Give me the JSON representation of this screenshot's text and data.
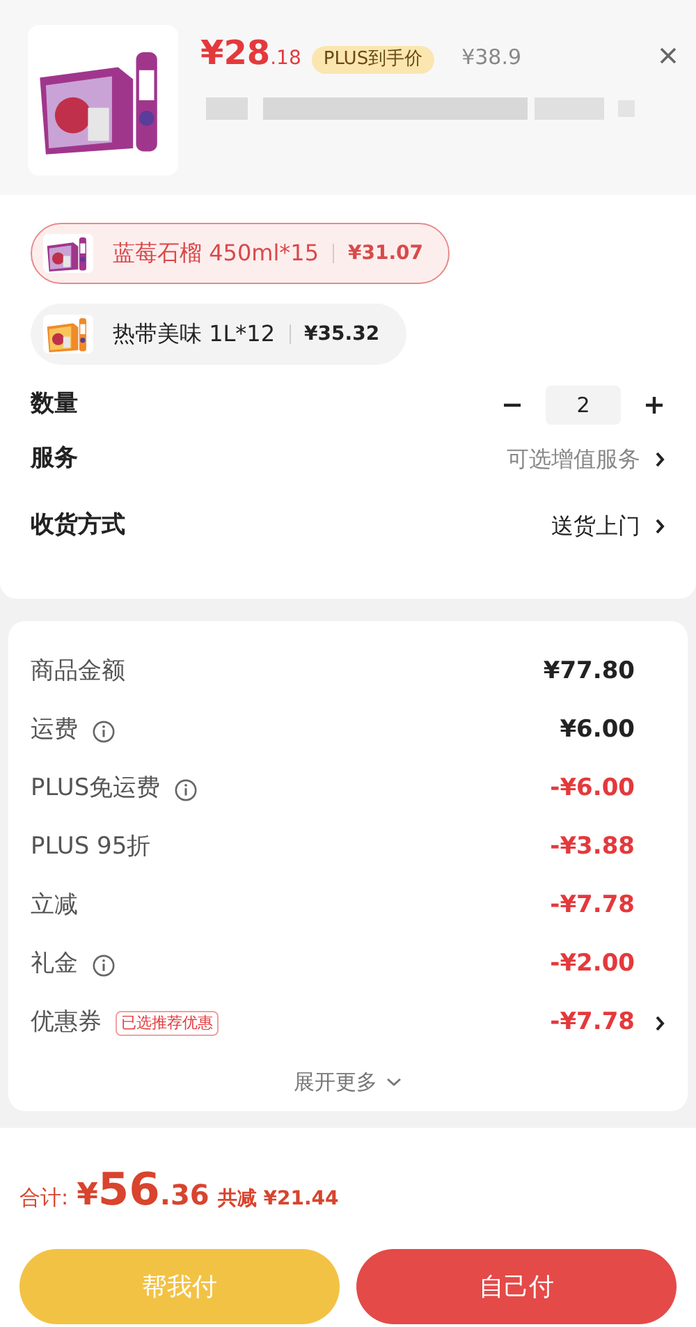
{
  "product": {
    "price_main": "¥28",
    "price_decimal": ".18",
    "price_tag": "PLUS到手价",
    "original_price": "¥38.9"
  },
  "variants": [
    {
      "label": "蓝莓石榴 450ml*15",
      "price": "¥31.07",
      "selected": true
    },
    {
      "label": "热带美味 1L*12",
      "price": "¥35.32",
      "selected": false
    }
  ],
  "quantity": {
    "label": "数量",
    "value": "2"
  },
  "options": [
    {
      "label": "服务",
      "value": "可选增值服务",
      "muted": true
    },
    {
      "label": "收货方式",
      "value": "送货上门",
      "muted": false
    }
  ],
  "fees": [
    {
      "label": "商品金额",
      "amount": "¥77.80",
      "discount": false,
      "info": false
    },
    {
      "label": "运费",
      "amount": "¥6.00",
      "discount": false,
      "info": true
    },
    {
      "label": "PLUS免运费",
      "amount": "-¥6.00",
      "discount": true,
      "info": true
    },
    {
      "label": "PLUS 95折",
      "amount": "-¥3.88",
      "discount": true,
      "info": false
    },
    {
      "label": "立减",
      "amount": "-¥7.78",
      "discount": true,
      "info": false
    },
    {
      "label": "礼金",
      "amount": "-¥2.00",
      "discount": true,
      "info": true
    },
    {
      "label": "优惠券",
      "amount": "-¥7.78",
      "discount": true,
      "info": false,
      "tag": "已选推荐优惠",
      "arrow": true
    }
  ],
  "expand": "展开更多",
  "total": {
    "label": "合计:",
    "currency": "¥",
    "main": "56",
    "decimal": ".36",
    "saved": "共减 ¥21.44"
  },
  "buttons": [
    {
      "label": "帮我付",
      "kind": "secondary"
    },
    {
      "label": "自己付",
      "kind": "primary"
    }
  ]
}
